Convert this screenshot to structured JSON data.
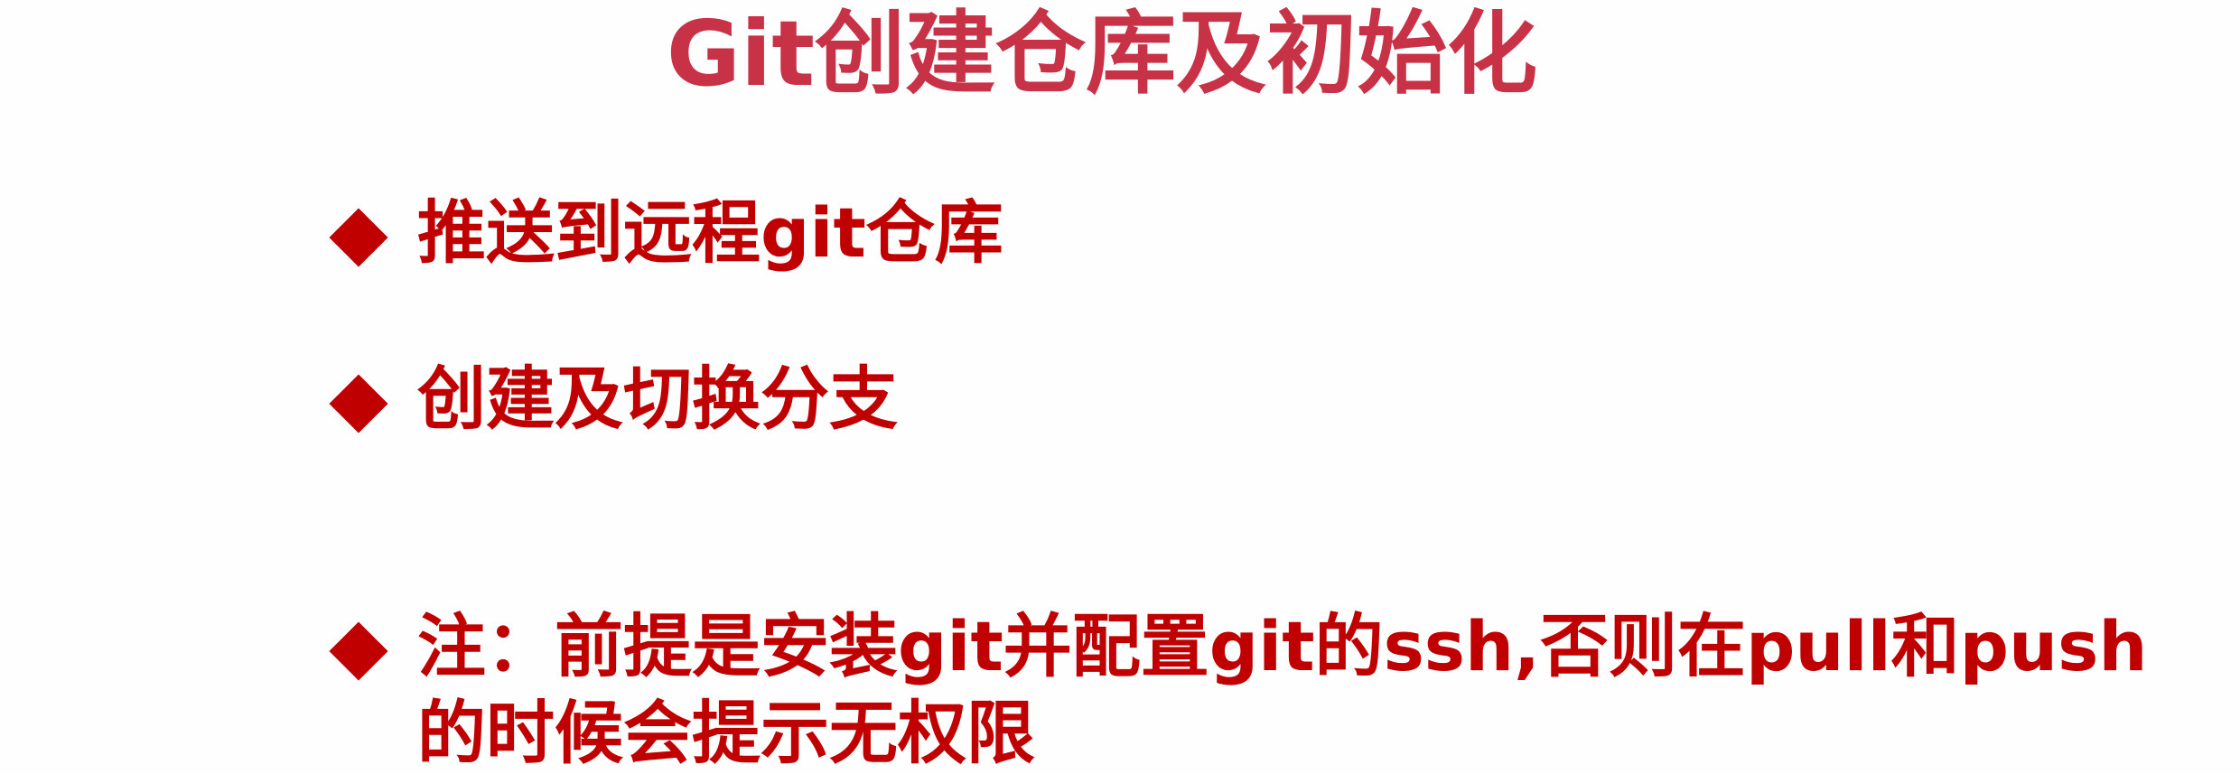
{
  "slide": {
    "title": "Git创建仓库及初始化",
    "bullets": [
      {
        "text": "推送到远程git仓库"
      },
      {
        "text": "创建及切换分支"
      },
      {
        "text": "注：前提是安装git并配置git的ssh,否则在pull和push的时候会提示无权限"
      }
    ],
    "colors": {
      "title": "#c83247",
      "bullet_text": "#c00000",
      "background": "#ffffff"
    }
  }
}
